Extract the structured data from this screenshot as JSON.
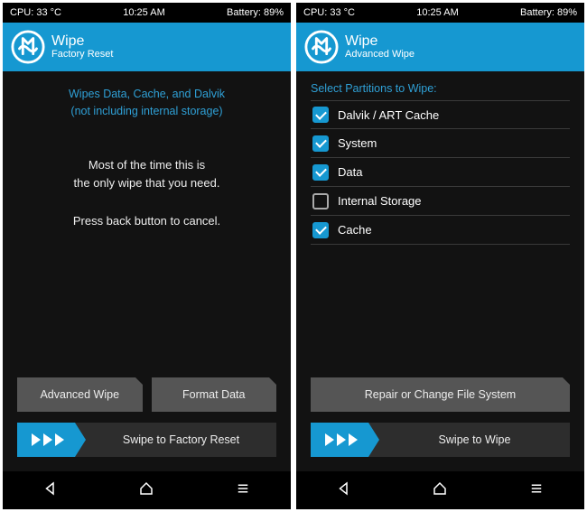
{
  "status": {
    "cpu": "CPU: 33 °C",
    "time": "10:25 AM",
    "battery": "Battery: 89%"
  },
  "left": {
    "title": "Wipe",
    "subtitle": "Factory Reset",
    "info1_line1": "Wipes Data, Cache, and Dalvik",
    "info1_line2": "(not including internal storage)",
    "info2_line1": "Most of the time this is",
    "info2_line2": "the only wipe that you need.",
    "info2_line3": "Press back button to cancel.",
    "btn_advanced": "Advanced Wipe",
    "btn_format": "Format Data",
    "slider_label": "Swipe to Factory Reset"
  },
  "right": {
    "title": "Wipe",
    "subtitle": "Advanced Wipe",
    "section_label": "Select Partitions to Wipe:",
    "partitions": [
      {
        "label": "Dalvik / ART Cache",
        "checked": true
      },
      {
        "label": "System",
        "checked": true
      },
      {
        "label": "Data",
        "checked": true
      },
      {
        "label": "Internal Storage",
        "checked": false
      },
      {
        "label": "Cache",
        "checked": true
      }
    ],
    "btn_repair": "Repair or Change File System",
    "slider_label": "Swipe to Wipe"
  }
}
